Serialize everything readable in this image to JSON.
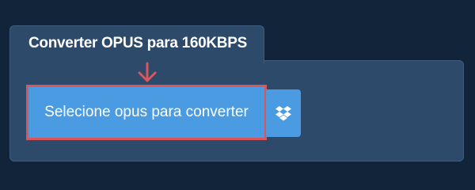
{
  "converter": {
    "title": "Converter OPUS para 160KBPS",
    "select_label": "Selecione opus para converter",
    "dropbox_icon": "dropbox-icon",
    "arrow_icon": "arrow-down-icon"
  },
  "colors": {
    "background": "#12243a",
    "panel": "#2d4a6b",
    "button": "#4b9be3",
    "highlight": "#d9565a"
  }
}
